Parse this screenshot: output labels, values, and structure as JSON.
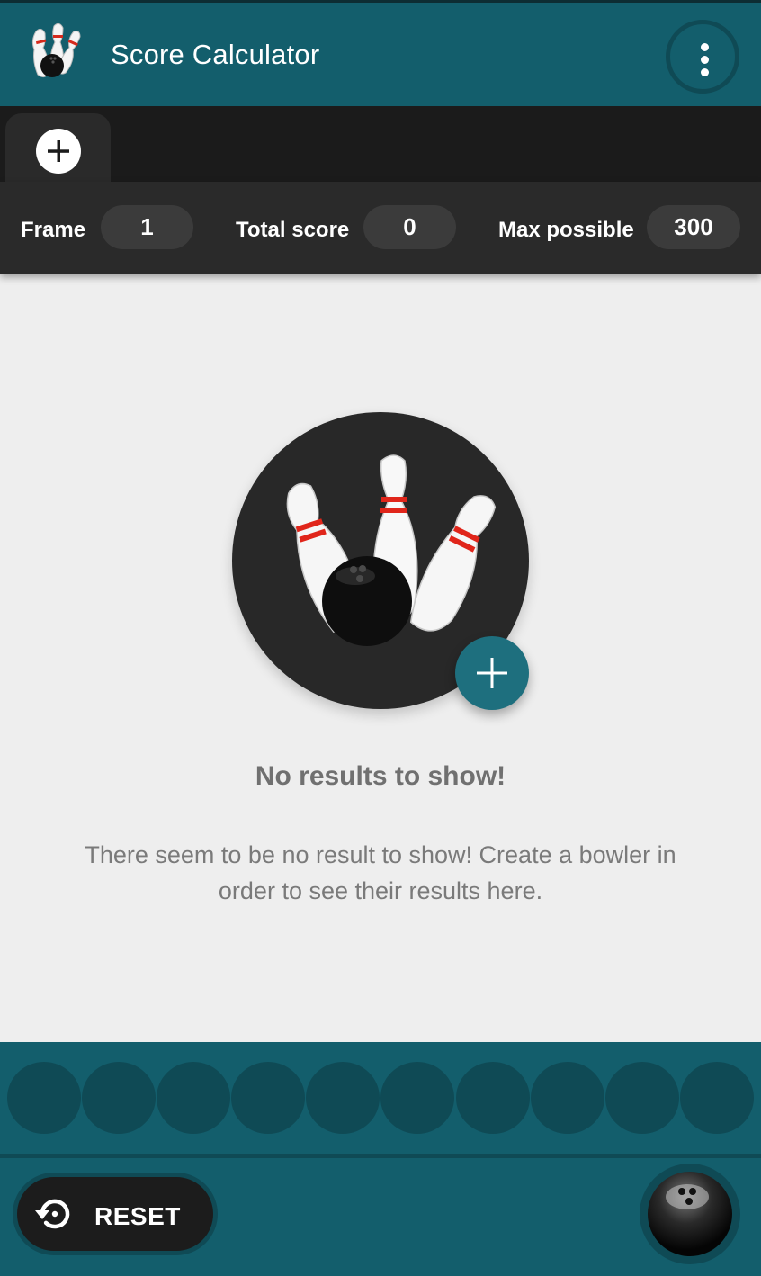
{
  "appbar": {
    "title": "Score Calculator",
    "logo_icon": "bowling-pins-logo-icon",
    "menu_icon": "more-vert-icon"
  },
  "tabs": {
    "add_icon": "add-circle-icon"
  },
  "stats": {
    "frame_label": "Frame",
    "frame_value": "1",
    "total_label": "Total score",
    "total_value": "0",
    "max_label": "Max possible",
    "max_value": "300"
  },
  "empty_state": {
    "illustration_icon": "bowling-pins-ball-icon",
    "add_icon": "add-icon",
    "title": "No results to show!",
    "description": "There seem to be no result to show! Create a bowler in order to see their results here."
  },
  "pin_selector": {
    "slots": 10
  },
  "bottom_bar": {
    "reset_label": "RESET",
    "reset_icon": "restore-icon",
    "throw_icon": "bowling-ball-icon"
  },
  "colors": {
    "primary": "#135e6c",
    "primary_dark": "#0f4a55",
    "fab": "#1e6f7e",
    "surface_dark": "#2a2a2a",
    "background": "#eeeeee"
  }
}
